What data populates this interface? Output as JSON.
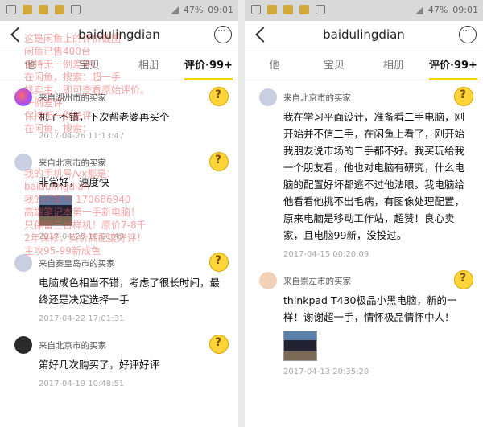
{
  "status": {
    "battery": "47%",
    "time": "09:01"
  },
  "nav": {
    "title": "baidulingdian"
  },
  "tabs_left": [
    "他",
    "宝贝",
    "相册",
    "评价·99+"
  ],
  "tabs_right": [
    "他",
    "宝贝",
    "相册",
    "评价·99+"
  ],
  "left_reviews": [
    {
      "buyer": "来自湖州市的买家",
      "content": "机子不错，下次帮老婆再买个",
      "time": "2017-04-26 11:13:47"
    },
    {
      "buyer": "来自北京市的买家",
      "content": "非常好，速度快",
      "time": "2017-04-25 10:01:49"
    },
    {
      "buyer": "来自秦皇岛市的买家",
      "content": "电脑成色相当不错，考虑了很长时间，最终还是决定选择一手",
      "time": "2017-04-22 17:01:31"
    },
    {
      "buyer": "来自北京市的买家",
      "content": "第好几次购买了，好评好评",
      "time": "2017-04-19 10:48:51"
    }
  ],
  "right_reviews": [
    {
      "buyer": "来自北京市的买家",
      "content": "我在学习平面设计，准备看二手电脑，刚开始并不信二手，在闲鱼上看了，刚开始我朋友说市场的二手都不好。我买玩给我一个朋友看，他也对电脑有研究，什么电脑的配置好坏都逃不过他法眼。我电脑给他看看他挑不出毛病，有图像处理配置，原来电脑是移动工作站，超赞！良心卖家，且电脑99新，没投过。",
      "time": "2017-04-15 00:20:09"
    },
    {
      "buyer": "来自崇左市的买家",
      "content": "thinkpad T430极品小黑电脑，新的一样！谢谢超一手，情怀极品情怀中人！",
      "time": "2017-04-13 20:35:20"
    }
  ],
  "watermark": [
    "这是闲鱼上的评价截图",
    "闲鱼已售400台",
    "保持无一例差评！",
    "在闲鱼，搜索：超一手",
    "找卖主，即可查看原始评价。",
    "一例差评",
    "保持无一例差评",
    "在闲鱼，搜索：",
    "我的手机号/vx都是：",
    "baidulingdian",
    "我的闲鱼号 170686940",
    "高端笔记本第一手新电脑！",
    "只保留三台样机！原价7-8千",
    "2年保修，卖价高配度好评！",
    "主攻95-99新成色"
  ]
}
